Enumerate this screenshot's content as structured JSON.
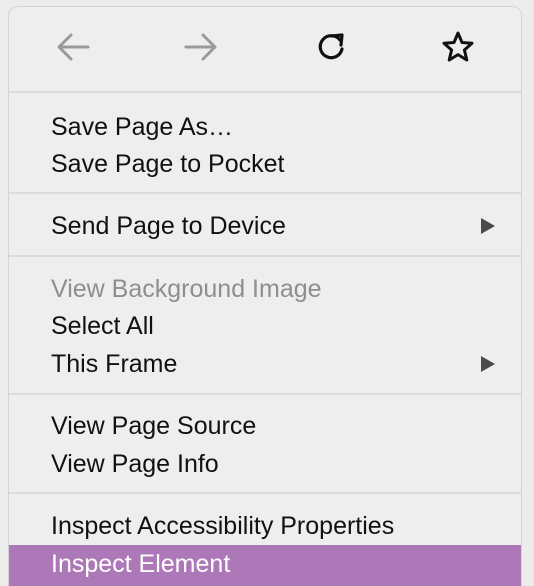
{
  "navigation": {
    "back_icon": "arrow-left-icon",
    "forward_icon": "arrow-right-icon",
    "reload_icon": "reload-icon",
    "bookmark_icon": "star-icon"
  },
  "menu": {
    "groups": [
      {
        "items": [
          {
            "label": "Save Page As…",
            "enabled": true
          },
          {
            "label": "Save Page to Pocket",
            "enabled": true
          }
        ]
      },
      {
        "items": [
          {
            "label": "Send Page to Device",
            "enabled": true,
            "submenu": true
          }
        ]
      },
      {
        "items": [
          {
            "label": "View Background Image",
            "enabled": false
          },
          {
            "label": "Select All",
            "enabled": true
          },
          {
            "label": "This Frame",
            "enabled": true,
            "submenu": true
          }
        ]
      },
      {
        "items": [
          {
            "label": "View Page Source",
            "enabled": true
          },
          {
            "label": "View Page Info",
            "enabled": true
          }
        ]
      },
      {
        "items": [
          {
            "label": "Inspect Accessibility Properties",
            "enabled": true
          },
          {
            "label": "Inspect Element",
            "enabled": true,
            "highlighted": true
          }
        ]
      }
    ]
  },
  "colors": {
    "highlight": "#ad78b7",
    "disabled_text": "#8e8e8e",
    "nav_disabled": "#9a9a9a",
    "nav_enabled": "#111111"
  }
}
